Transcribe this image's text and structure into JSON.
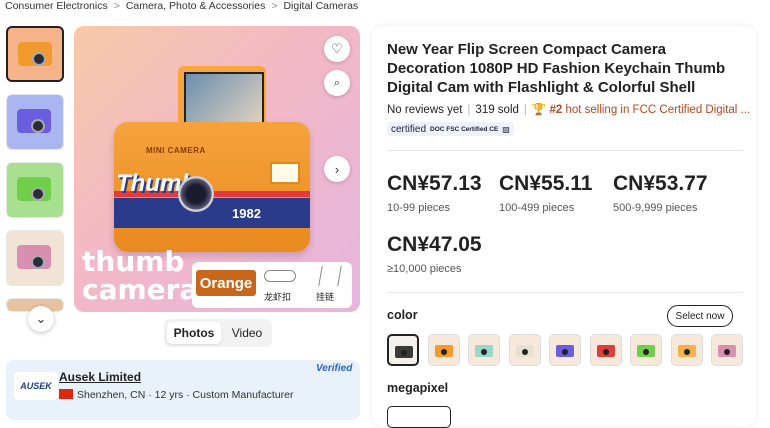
{
  "breadcrumb": [
    "Consumer Electronics",
    "Camera, Photo & Accessories",
    "Digital Cameras"
  ],
  "gallery": {
    "thumbnails": [
      {
        "bg": "#f5b389",
        "cam": "#f29a2e"
      },
      {
        "bg": "#a9b6f2",
        "cam": "#6a5de0"
      },
      {
        "bg": "#a9e08f",
        "cam": "#6fcf4a"
      },
      {
        "bg": "#f2e4d4",
        "cam": "#d98fb0"
      },
      {
        "bg": "#e8c3a0",
        "cam": "#e09a33"
      }
    ],
    "main_image": {
      "camera_label": "MINI CAMERA",
      "camera_brand": "Thumb",
      "camera_number": "1982",
      "tagline_line1": "thumb",
      "tagline_line2": "camera",
      "color_chip": "Orange",
      "accessory1": "龙虾扣",
      "accessory2": "挂链"
    },
    "tabs": [
      "Photos",
      "Video"
    ],
    "icons": {
      "favorite": "heart-icon",
      "image_search": "image-search-icon",
      "next": "chevron-right-icon",
      "scroll_down": "chevron-down-icon"
    }
  },
  "supplier": {
    "logo_text": "AUSEK",
    "name": "Ausek Limited",
    "meta": "Shenzhen, CN · 12 yrs · Custom Manufacturer",
    "badge": "Verified"
  },
  "product": {
    "title": "New Year Flip Screen Compact Camera Decoration 1080P HD Fashion Keychain Thumb Digital Cam with Flashlight & Colorful Shell",
    "reviews": "No reviews yet",
    "sold": "319 sold",
    "rank_num": "#2",
    "rank_text": "hot selling in FCC Certified Digital ...",
    "certified_label": "certified",
    "cert_marks": "DOC FSC Certified CE",
    "prices": [
      {
        "price": "CN¥57.13",
        "qty": "10-99 pieces"
      },
      {
        "price": "CN¥55.11",
        "qty": "100-499 pieces"
      },
      {
        "price": "CN¥53.77",
        "qty": "500-9,999 pieces"
      },
      {
        "price": "CN¥47.05",
        "qty": "≥10,000 pieces"
      }
    ],
    "color_label": "color",
    "select_now": "Select now",
    "swatches": [
      "#3a3a3a",
      "#f29a2e",
      "#9ad6c9",
      "#e8e0d0",
      "#6a5de0",
      "#e23b3b",
      "#6fcf4a",
      "#f5b14a",
      "#d98fb0"
    ],
    "megapixel_label": "megapixel"
  }
}
